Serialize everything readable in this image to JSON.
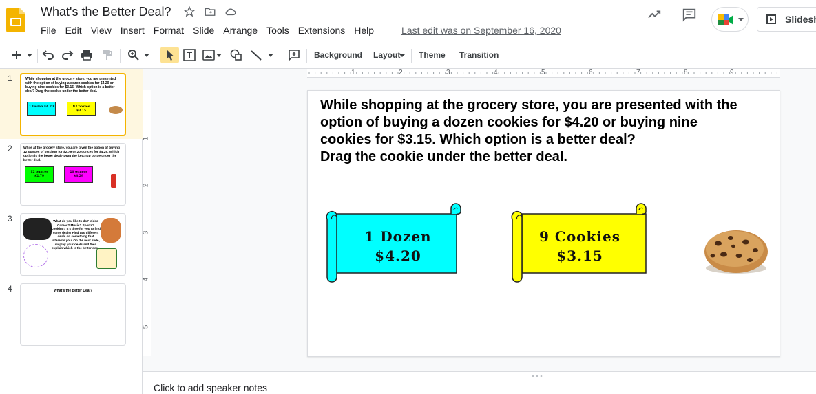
{
  "app": {
    "title": "What's the Better Deal?",
    "menu": [
      "File",
      "Edit",
      "View",
      "Insert",
      "Format",
      "Slide",
      "Arrange",
      "Tools",
      "Extensions",
      "Help"
    ],
    "last_edit": "Last edit was on September 16, 2020",
    "slideshow_label": "Slidesh"
  },
  "toolbar": {
    "background_label": "Background",
    "layout_label": "Layout",
    "theme_label": "Theme",
    "transition_label": "Transition"
  },
  "ruler": {
    "top_numbers": [
      "1",
      "2",
      "3",
      "4",
      "5",
      "6",
      "7",
      "8",
      "9"
    ],
    "left_numbers": [
      "1",
      "2",
      "3",
      "4",
      "5"
    ]
  },
  "filmstrip": {
    "slides": [
      {
        "number": "1",
        "text": "While shopping at the grocery store, you are presented with the option of buying a dozen cookies for $4.20 or buying nine cookies for $3.15. Which option is a better deal? Drag the cookie under the better deal.",
        "label_a": "1 Dozen $4.20",
        "label_b": "9 Cookies $3.15"
      },
      {
        "number": "2",
        "text": "While at the grocery store, you are given the option of buying 12 ounces of ketchup for $2.79 or 20 ounces for $4.29. Which option is the better deal? Drag the ketchup bottle under the better deal.",
        "label_a": "12 ounces $2.79",
        "label_b": "20 ounces $4.29"
      },
      {
        "number": "3",
        "text": "What do you like to do? Video Games? Music? Sports? Cooking? It's time for you to find some deals! Find two different deals on something that interests you. On the next slide, display your deals and then explain which is the better deal."
      },
      {
        "number": "4",
        "text": "What's the Better Deal?"
      }
    ]
  },
  "slide": {
    "text_line1": "While shopping at the grocery store, you are presented with the",
    "text_line2": "option of buying a dozen cookies for $4.20 or buying nine",
    "text_line3": "cookies for $3.15. Which option is a better deal?",
    "text_line4": "Drag the cookie under the better deal.",
    "banner1": {
      "line1": "1 Dozen",
      "line2": "$4.20",
      "color": "#00ffff"
    },
    "banner2": {
      "line1": "9 Cookies",
      "line2": "$3.15",
      "color": "#ffff00"
    }
  },
  "notes": {
    "placeholder": "Click to add speaker notes"
  },
  "colors": {
    "accent": "#f4b400",
    "select_highlight": "#fde293"
  }
}
